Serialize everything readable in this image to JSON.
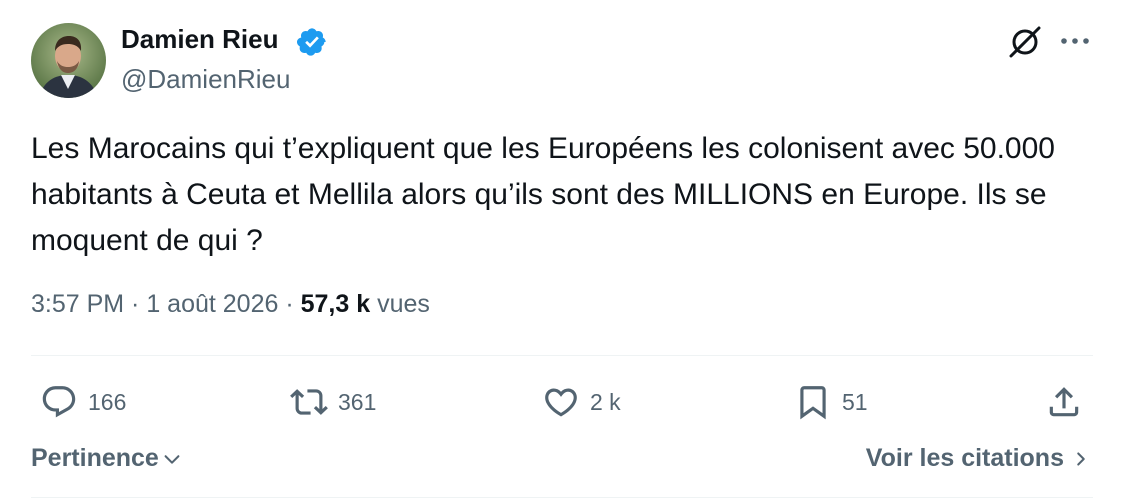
{
  "author": {
    "display_name": "Damien Rieu",
    "handle": "@DamienRieu",
    "verified": true,
    "verified_color": "#1d9bf0"
  },
  "tweet": {
    "text": "Les Marocains qui t’expliquent que les Européens les colonisent avec 50.000 habitants à Ceuta et Mellila alors qu’ils sont des MILLIONS en Europe. Ils se moquent de qui ?",
    "time": "3:57 PM",
    "separator": " · ",
    "date": "1 août 2026",
    "views_count": "57,3 k",
    "views_label": "vues"
  },
  "header_icons": {
    "grok": "grok-icon",
    "more": "more-icon"
  },
  "actions": {
    "reply": {
      "icon": "reply-icon",
      "count": "166"
    },
    "repost": {
      "icon": "repost-icon",
      "count": "361"
    },
    "like": {
      "icon": "heart-icon",
      "count": "2 k"
    },
    "bookmark": {
      "icon": "bookmark-icon",
      "count": "51"
    },
    "share": {
      "icon": "share-icon"
    }
  },
  "footer": {
    "sort_label": "Pertinence",
    "quotes_label": "Voir les citations"
  },
  "colors": {
    "text_primary": "#0f1419",
    "text_secondary": "#536471",
    "divider": "#eff3f4"
  }
}
